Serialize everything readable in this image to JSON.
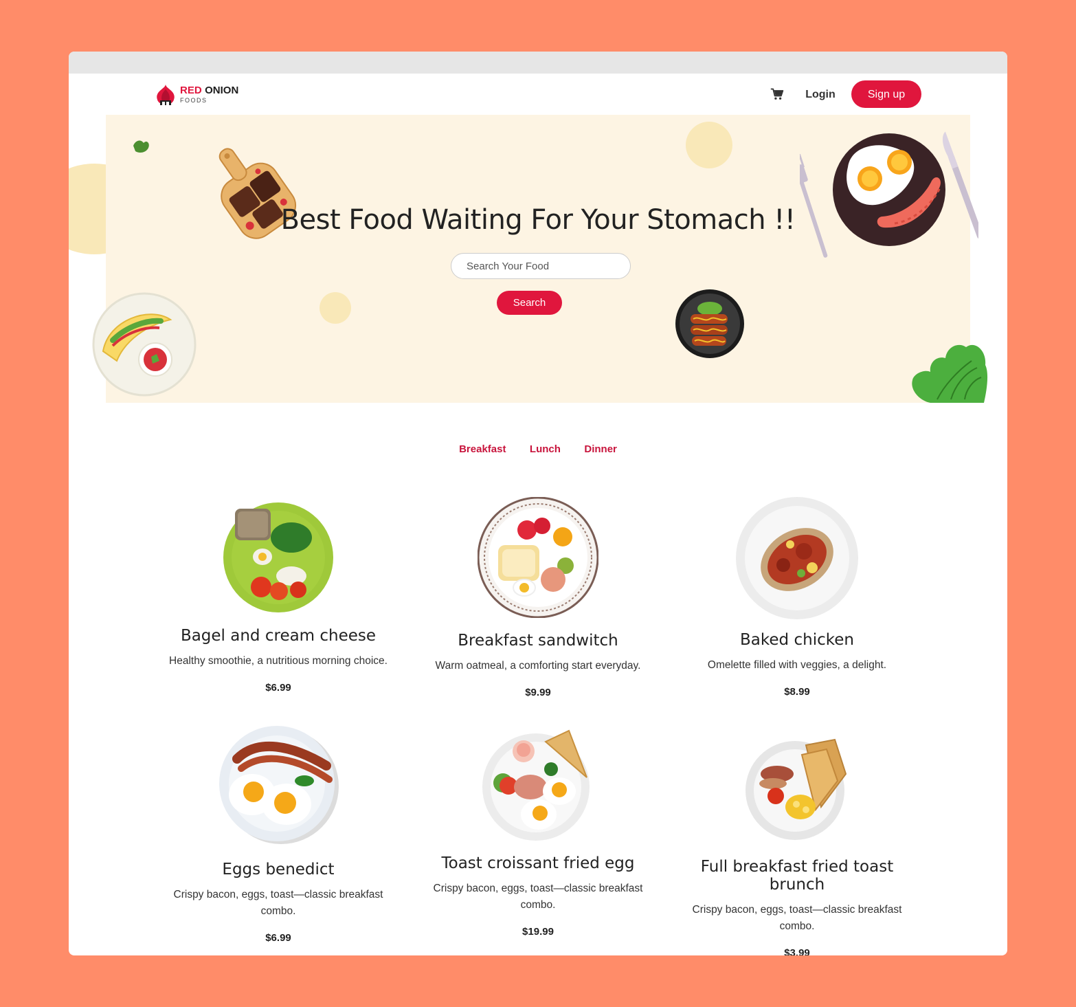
{
  "brand": {
    "name_red": "RED",
    "name_dark": "ONION",
    "sub": "FOODS",
    "accent": "#e0163d"
  },
  "nav": {
    "cart_icon": "cart-icon",
    "login": "Login",
    "signup": "Sign up"
  },
  "hero": {
    "title": "Best Food Waiting For Your Stomach !!",
    "search_placeholder": "Search Your Food",
    "search_button": "Search"
  },
  "tabs": [
    "Breakfast",
    "Lunch",
    "Dinner"
  ],
  "items": [
    {
      "title": "Bagel and cream cheese",
      "desc": "Healthy smoothie, a nutritious morning choice.",
      "price": "$6.99"
    },
    {
      "title": "Breakfast sandwitch",
      "desc": "Warm oatmeal, a comforting start everyday.",
      "price": "$9.99"
    },
    {
      "title": "Baked chicken",
      "desc": "Omelette filled with veggies, a delight.",
      "price": "$8.99"
    },
    {
      "title": "Eggs benedict",
      "desc": "Crispy bacon, eggs, toast—classic breakfast combo.",
      "price": "$6.99"
    },
    {
      "title": "Toast croissant fried egg",
      "desc": "Crispy bacon, eggs, toast—classic breakfast combo.",
      "price": "$19.99"
    },
    {
      "title": "Full breakfast fried toast brunch",
      "desc": "Crispy bacon, eggs, toast—classic breakfast combo.",
      "price": "$3.99"
    }
  ]
}
